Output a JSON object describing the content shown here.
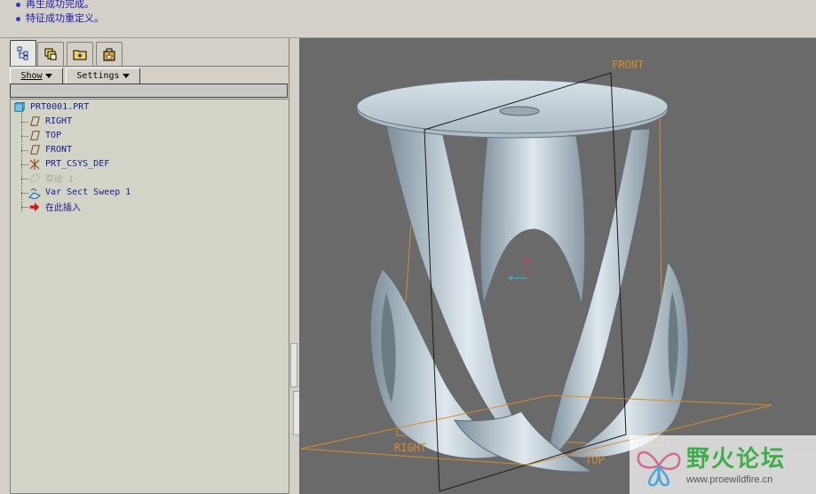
{
  "messages": [
    "再生成功完成。",
    "特征成功重定义。"
  ],
  "tabs": [
    {
      "name": "tab-model-tree",
      "icon": "model-tree-icon"
    },
    {
      "name": "tab-layers",
      "icon": "layers-icon"
    },
    {
      "name": "tab-folder-browser",
      "icon": "folder-icon"
    },
    {
      "name": "tab-favorites",
      "icon": "favorites-icon"
    }
  ],
  "toolbar": {
    "show_label": "Show",
    "settings_label": "Settings"
  },
  "tree": {
    "root": "PRT0001.PRT",
    "items": [
      {
        "label": "RIGHT",
        "icon": "datum-plane-icon"
      },
      {
        "label": "TOP",
        "icon": "datum-plane-icon"
      },
      {
        "label": "FRONT",
        "icon": "datum-plane-icon"
      },
      {
        "label": "PRT_CSYS_DEF",
        "icon": "csys-icon"
      },
      {
        "label": "草绘 1",
        "icon": "sketch-icon"
      },
      {
        "label": "Var Sect Sweep 1",
        "icon": "sweep-icon"
      },
      {
        "label": "在此插入",
        "icon": "insert-here-arrow-icon"
      }
    ]
  },
  "viewport": {
    "datum_labels": {
      "front": "FRONT",
      "right": "RIGHT",
      "top": "TOP"
    },
    "colors": {
      "background": "#6a6a6a",
      "datum": "#d88a2c",
      "part": "#c9d6dd"
    }
  },
  "watermark": {
    "title": "野火论坛",
    "url": "www.proewildfire.cn"
  }
}
